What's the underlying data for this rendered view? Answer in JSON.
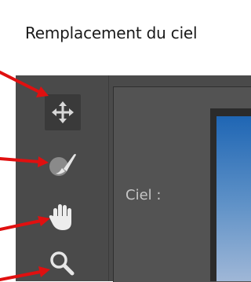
{
  "dialog": {
    "title": "Remplacement du ciel"
  },
  "tools": [
    {
      "icon": "move-icon",
      "active": true
    },
    {
      "icon": "sky-brush-icon",
      "active": false
    },
    {
      "icon": "hand-icon",
      "active": false
    },
    {
      "icon": "zoom-icon",
      "active": false
    }
  ],
  "sky": {
    "label": "Ciel :"
  },
  "colors": {
    "annotation_arrow": "#e01010",
    "panel": "#4a4a4a",
    "content": "#535353",
    "sky_top": "#1f66b4",
    "sky_bottom": "#9fb7d7"
  }
}
